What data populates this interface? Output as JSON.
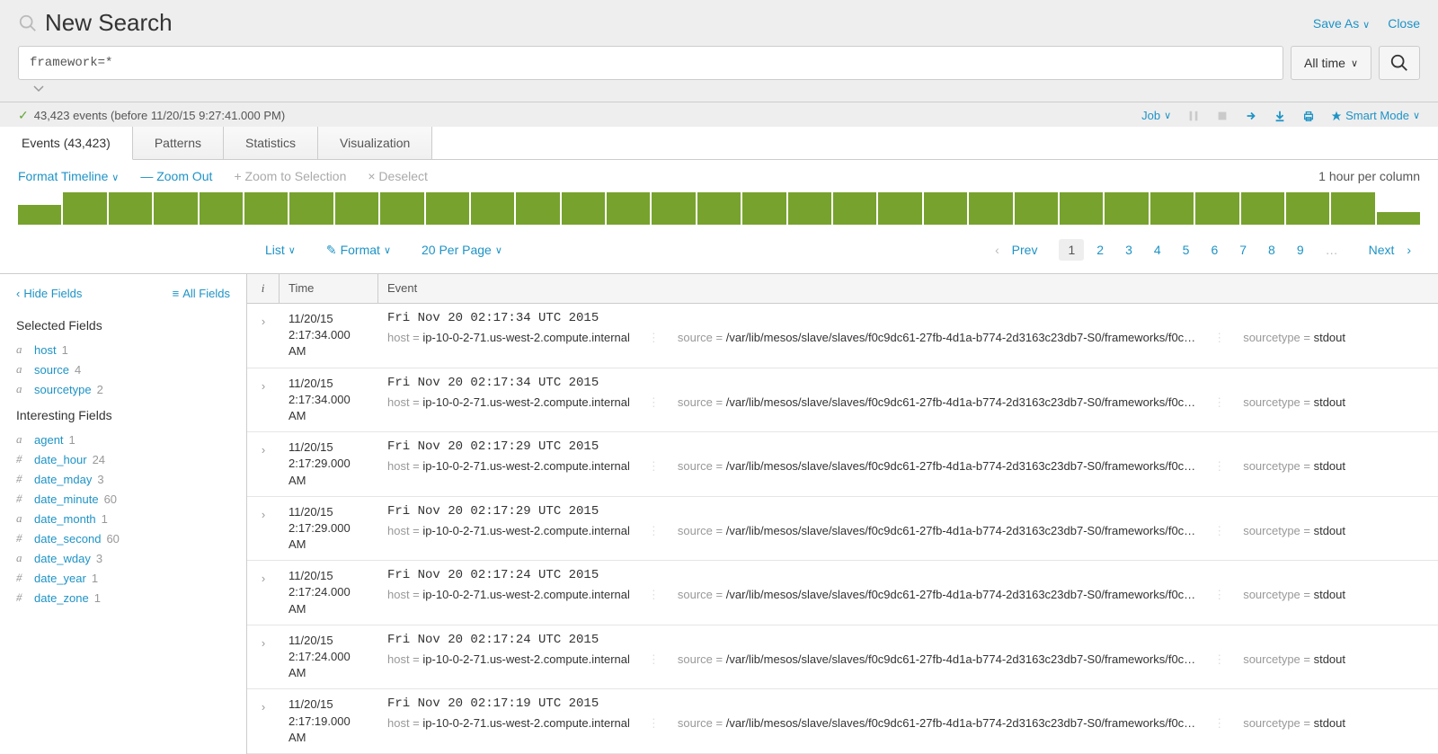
{
  "header": {
    "title": "New Search",
    "save_as": "Save As",
    "close": "Close",
    "search_value": "framework=*",
    "time_picker": "All time",
    "status": "43,423 events (before 11/20/15 9:27:41.000 PM)",
    "job_label": "Job",
    "smart_mode": "Smart Mode"
  },
  "tabs": {
    "events": "Events (43,423)",
    "patterns": "Patterns",
    "statistics": "Statistics",
    "visualization": "Visualization"
  },
  "timeline": {
    "format": "Format Timeline",
    "zoom_out": "— Zoom Out",
    "zoom_sel": "+ Zoom to Selection",
    "deselect": "× Deselect",
    "scale": "1 hour per column"
  },
  "list_ctrls": {
    "list": "List",
    "format": "Format",
    "per_page": "20 Per Page"
  },
  "pager": {
    "prev": "Prev",
    "pages": [
      "1",
      "2",
      "3",
      "4",
      "5",
      "6",
      "7",
      "8",
      "9"
    ],
    "next": "Next"
  },
  "fields": {
    "hide": "Hide Fields",
    "all": "All Fields",
    "selected_hdr": "Selected Fields",
    "selected": [
      {
        "t": "a",
        "n": "host",
        "c": "1"
      },
      {
        "t": "a",
        "n": "source",
        "c": "4"
      },
      {
        "t": "a",
        "n": "sourcetype",
        "c": "2"
      }
    ],
    "interesting_hdr": "Interesting Fields",
    "interesting": [
      {
        "t": "a",
        "n": "agent",
        "c": "1"
      },
      {
        "t": "#",
        "n": "date_hour",
        "c": "24"
      },
      {
        "t": "#",
        "n": "date_mday",
        "c": "3"
      },
      {
        "t": "#",
        "n": "date_minute",
        "c": "60"
      },
      {
        "t": "a",
        "n": "date_month",
        "c": "1"
      },
      {
        "t": "#",
        "n": "date_second",
        "c": "60"
      },
      {
        "t": "a",
        "n": "date_wday",
        "c": "3"
      },
      {
        "t": "#",
        "n": "date_year",
        "c": "1"
      },
      {
        "t": "#",
        "n": "date_zone",
        "c": "1"
      }
    ]
  },
  "ev_head": {
    "i": "i",
    "time": "Time",
    "event": "Event"
  },
  "events": [
    {
      "d": "11/20/15",
      "t": "2:17:34.000 AM",
      "raw": "Fri Nov 20 02:17:34 UTC 2015",
      "host": "ip-10-0-2-71.us-west-2.compute.internal",
      "source": "/var/lib/mesos/slave/slaves/f0c9dc61-27fb-4d1a-b774-2d3163c23db7-S0/frameworks/f0c…",
      "st": "stdout"
    },
    {
      "d": "11/20/15",
      "t": "2:17:34.000 AM",
      "raw": "Fri Nov 20 02:17:34 UTC 2015",
      "host": "ip-10-0-2-71.us-west-2.compute.internal",
      "source": "/var/lib/mesos/slave/slaves/f0c9dc61-27fb-4d1a-b774-2d3163c23db7-S0/frameworks/f0c…",
      "st": "stdout"
    },
    {
      "d": "11/20/15",
      "t": "2:17:29.000 AM",
      "raw": "Fri Nov 20 02:17:29 UTC 2015",
      "host": "ip-10-0-2-71.us-west-2.compute.internal",
      "source": "/var/lib/mesos/slave/slaves/f0c9dc61-27fb-4d1a-b774-2d3163c23db7-S0/frameworks/f0c…",
      "st": "stdout"
    },
    {
      "d": "11/20/15",
      "t": "2:17:29.000 AM",
      "raw": "Fri Nov 20 02:17:29 UTC 2015",
      "host": "ip-10-0-2-71.us-west-2.compute.internal",
      "source": "/var/lib/mesos/slave/slaves/f0c9dc61-27fb-4d1a-b774-2d3163c23db7-S0/frameworks/f0c…",
      "st": "stdout"
    },
    {
      "d": "11/20/15",
      "t": "2:17:24.000 AM",
      "raw": "Fri Nov 20 02:17:24 UTC 2015",
      "host": "ip-10-0-2-71.us-west-2.compute.internal",
      "source": "/var/lib/mesos/slave/slaves/f0c9dc61-27fb-4d1a-b774-2d3163c23db7-S0/frameworks/f0c…",
      "st": "stdout"
    },
    {
      "d": "11/20/15",
      "t": "2:17:24.000 AM",
      "raw": "Fri Nov 20 02:17:24 UTC 2015",
      "host": "ip-10-0-2-71.us-west-2.compute.internal",
      "source": "/var/lib/mesos/slave/slaves/f0c9dc61-27fb-4d1a-b774-2d3163c23db7-S0/frameworks/f0c…",
      "st": "stdout"
    },
    {
      "d": "11/20/15",
      "t": "2:17:19.000 AM",
      "raw": "Fri Nov 20 02:17:19 UTC 2015",
      "host": "ip-10-0-2-71.us-west-2.compute.internal",
      "source": "/var/lib/mesos/slave/slaves/f0c9dc61-27fb-4d1a-b774-2d3163c23db7-S0/frameworks/f0c…",
      "st": "stdout"
    }
  ],
  "labels": {
    "host": "host = ",
    "source": "source = ",
    "sourcetype": "sourcetype = "
  }
}
